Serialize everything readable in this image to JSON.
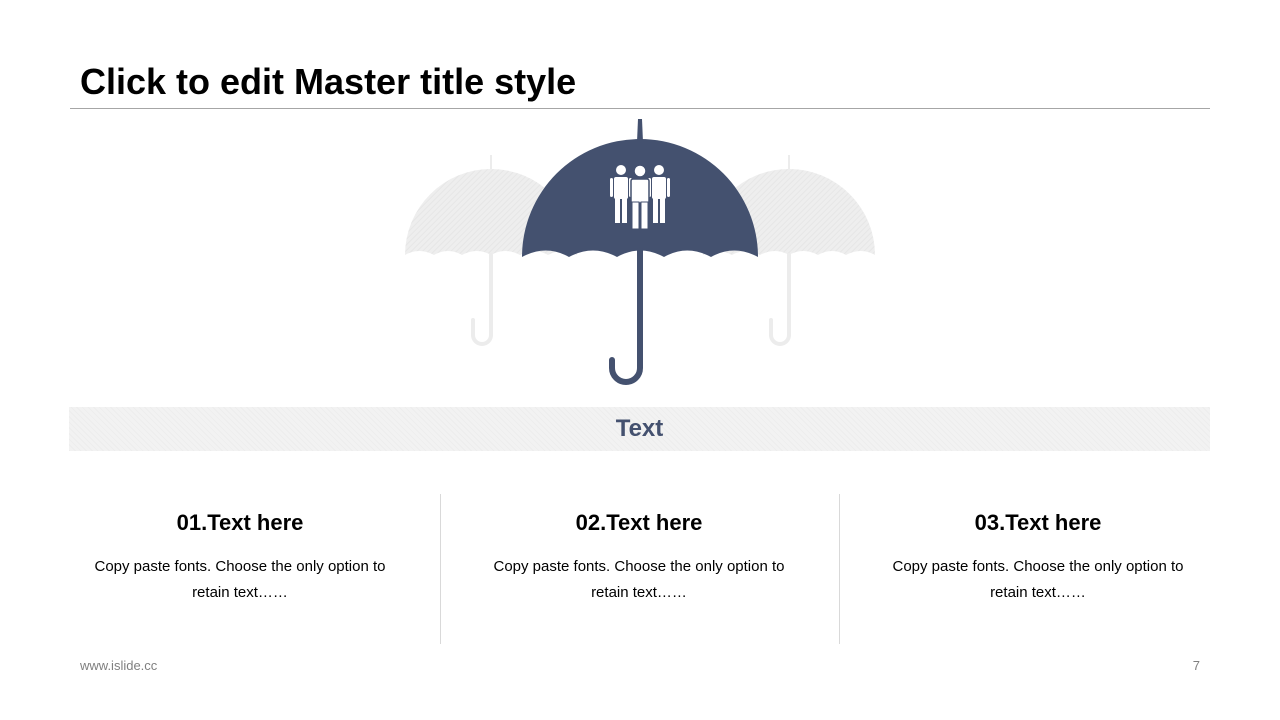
{
  "slide": {
    "title": "Click to edit Master title style",
    "banner_text": "Text",
    "footer_url": "www.islide.cc",
    "page_number": "7"
  },
  "columns": [
    {
      "heading": "01.Text here",
      "body": "Copy paste fonts. Choose the only option to retain text……"
    },
    {
      "heading": "02.Text here",
      "body": "Copy paste fonts. Choose the only option to retain text……"
    },
    {
      "heading": "03.Text here",
      "body": "Copy paste fonts. Choose the only option to retain text……"
    }
  ],
  "graphic": {
    "main_icon": "umbrella-icon",
    "people_icon": "people-group-icon",
    "ghost_icon": "umbrella-icon"
  },
  "colors": {
    "accent": "#44516f",
    "ghost": "#ededed",
    "banner_bg": "#f2f2f2",
    "divider": "#d9d9d9",
    "footer": "#7f7f7f"
  }
}
